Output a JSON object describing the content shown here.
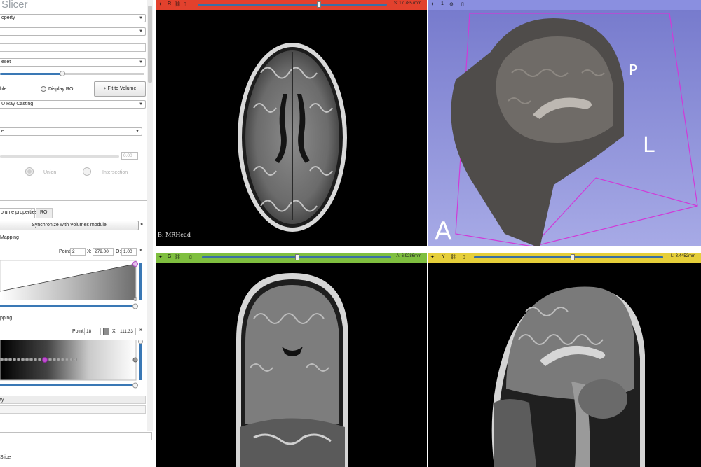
{
  "app": {
    "title": "Slicer"
  },
  "panel": {
    "property_combo": "operty",
    "preset_combo": "eset",
    "display_label": "ble",
    "display_roi_label": "Display ROI",
    "fit_to_volume_label": "Fit to Volume",
    "rendering_method": "U Ray Casting",
    "roi_combo": "e",
    "crop_value": "0.00",
    "union_label": "Union",
    "intersection_label": "Intersection",
    "tabs": [
      {
        "label": "olume properties"
      },
      {
        "label": "ROI"
      }
    ],
    "sync_button_label": "Synchronize with Volumes module",
    "scalar_mapping": {
      "title": "Mapping",
      "point_label": "Point:",
      "point_value": "2",
      "x_label": "X:",
      "x_value": "279.00",
      "o_label": "O:",
      "o_value": "1.00"
    },
    "color_mapping": {
      "title": "pping",
      "point_label": "Point:",
      "point_value": "18",
      "x_label": "X:",
      "x_value": "111.33"
    },
    "advanced_label": "ty",
    "module_footer": "Slice"
  },
  "views": {
    "red": {
      "letter": "R",
      "offset": "S: 17.7857mm",
      "volume_label": "B: MRHead",
      "color": "#e2412d"
    },
    "three_d": {
      "letter": "1",
      "color": "#8a8fe0",
      "orientation": [
        "P",
        "L",
        "A"
      ]
    },
    "green": {
      "letter": "G",
      "offset": "A: 6.9286mm",
      "color": "#7fbf3f"
    },
    "yellow": {
      "letter": "Y",
      "offset": "L: 3.4452mm",
      "color": "#e6cf3a"
    }
  }
}
